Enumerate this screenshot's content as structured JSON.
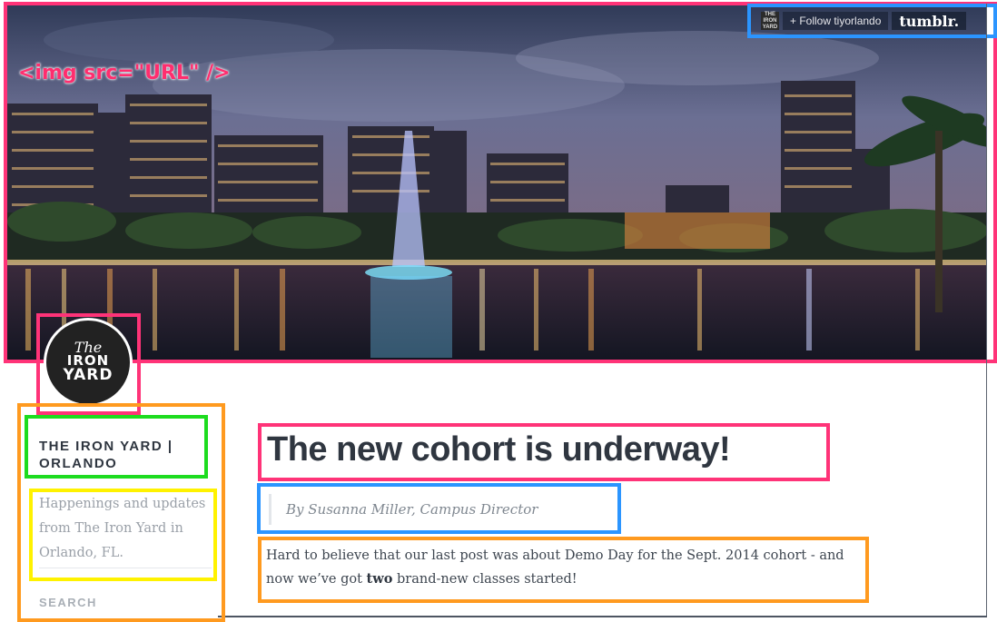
{
  "hero": {
    "image_tag_label": "<img src=\"URL\" />"
  },
  "tumblr_bar": {
    "avatar_text": "THE IRON YARD",
    "follow_label": "+ Follow tiyorlando",
    "logo_text": "tumblr."
  },
  "logo": {
    "line1": "The",
    "line2": "IRON",
    "line3": "YARD"
  },
  "sidebar": {
    "site_title": "THE IRON YARD | ORLANDO",
    "description": "Happenings and updates from The Iron Yard in Orlando, FL.",
    "search_label": "SEARCH"
  },
  "post": {
    "title": "The new cohort is underway!",
    "byline": "By Susanna Miller, Campus Director",
    "body_before": "Hard to believe that our last post was about Demo Day for the Sept. 2014 cohort - and now we’ve got ",
    "body_bold": "two",
    "body_after": " brand-new classes started!"
  },
  "colors": {
    "annotation_pink": "#ff3378",
    "annotation_blue": "#2b95ff",
    "annotation_orange": "#ff9a1f",
    "annotation_green": "#1ddc1f",
    "annotation_yellow": "#fff200",
    "heading_text": "#2f3640",
    "muted_text": "#9aa0a8"
  }
}
